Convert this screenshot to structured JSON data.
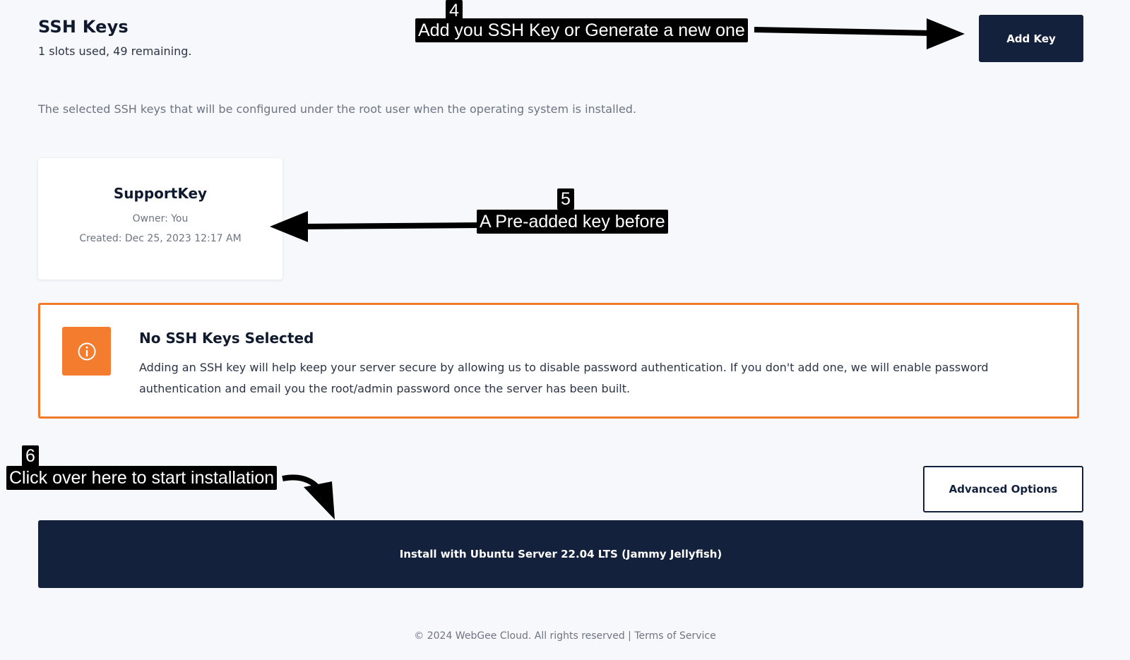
{
  "header": {
    "title": "SSH Keys",
    "slots_text": "1 slots used, 49 remaining.",
    "add_key_label": "Add Key"
  },
  "description": "The selected SSH keys that will be configured under the root user when the operating system is installed.",
  "key_card": {
    "name": "SupportKey",
    "owner": "Owner: You",
    "created": "Created: Dec 25, 2023 12:17 AM"
  },
  "alert": {
    "icon": "info-icon",
    "title": "No SSH Keys Selected",
    "body": "Adding an SSH key will help keep your server secure by allowing us to disable password authentication. If you don't add one, we will enable password authentication and email you the root/admin password once the server has been built."
  },
  "actions": {
    "advanced_label": "Advanced Options",
    "install_label": "Install with Ubuntu Server 22.04 LTS (Jammy Jellyfish)"
  },
  "footer": {
    "copyright": "© 2024 WebGee Cloud. All rights reserved",
    "separator": "|",
    "terms": "Terms of Service"
  },
  "annotations": [
    {
      "number": "4",
      "text": "Add you SSH Key or Generate a new one"
    },
    {
      "number": "5",
      "text": "A Pre-added key before"
    },
    {
      "number": "6",
      "text": "Click over here to start installation"
    }
  ],
  "colors": {
    "background": "#f6f8fc",
    "primary_dark": "#13213c",
    "alert_orange": "#f47c2f",
    "annotation_black": "#000000"
  }
}
